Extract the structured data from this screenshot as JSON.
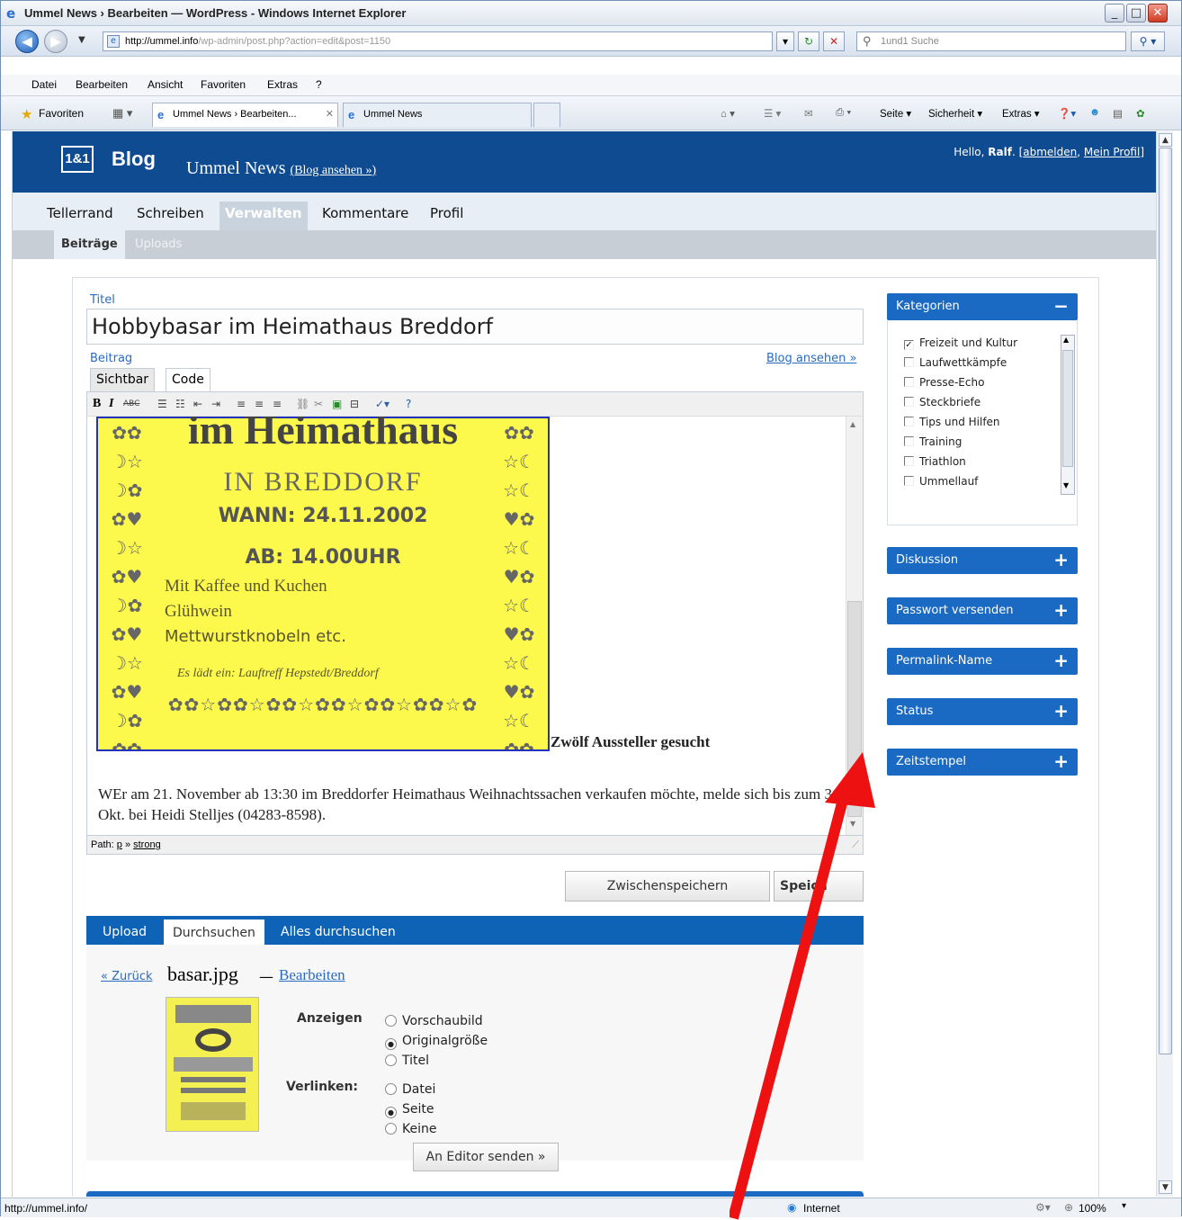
{
  "window": {
    "title": "Ummel News › Bearbeiten — WordPress - Windows Internet Explorer"
  },
  "addressbar": {
    "url_domain": "http://ummel.info",
    "url_path": "/wp-admin/post.php?action=edit&post=1150",
    "search_placeholder": "1und1 Suche"
  },
  "menu": [
    "Datei",
    "Bearbeiten",
    "Ansicht",
    "Favoriten",
    "Extras",
    "?"
  ],
  "favorites": {
    "label": "Favoriten",
    "tabs": [
      "Ummel News › Bearbeiten...",
      "Ummel News"
    ],
    "tools": [
      "Seite ▾",
      "Sicherheit ▾",
      "Extras ▾"
    ]
  },
  "wp_header": {
    "logo": "1&1",
    "blog_word": "Blog",
    "site_name": "Ummel News",
    "view_blog": "(Blog ansehen »)",
    "hello_prefix": "Hello, ",
    "user": "Ralf",
    "logout": "abmelden",
    "profile": "Mein Profil"
  },
  "nav_main": [
    "Tellerrand",
    "Schreiben",
    "Verwalten",
    "Kommentare",
    "Profil"
  ],
  "nav_sub": [
    "Beiträge",
    "Uploads"
  ],
  "editor": {
    "title_label": "Titel",
    "title_value": "Hobbybasar im Heimathaus Breddorf",
    "post_label": "Beitrag",
    "blog_link": "Blog ansehen »",
    "tabs": [
      "Sichtbar",
      "Code"
    ],
    "poster": {
      "line1": "im Heimathaus",
      "line2": "IN BREDDORF",
      "line3": "WANN: 24.11.2002",
      "line4": "AB: 14.00UHR",
      "line5": "Mit Kaffee und Kuchen",
      "line6": "Glühwein",
      "line7": "Mettwurstknobeln etc.",
      "line8": "Es lädt ein: Lauftreff Hepstedt/Breddorf"
    },
    "heading": "Zwölf Aussteller gesucht",
    "body": "WEr am 21. November ab 13:30 im Breddorfer Heimathaus Weihnachtssachen verkaufen möchte, melde sich bis zum 31. Okt. bei Heidi Stelljes (04283-8598).",
    "path_label": "Path:",
    "path_p": "p",
    "path_sep": "»",
    "path_strong": "strong",
    "save_draft": "Zwischenspeichern",
    "save": "Speich"
  },
  "upload": {
    "tabs": [
      "Upload",
      "Durchsuchen",
      "Alles durchsuchen"
    ],
    "back": "« Zurück",
    "filename": "basar.jpg",
    "dash": "—",
    "edit": "Bearbeiten",
    "show_label": "Anzeigen",
    "show_options": [
      "Vorschaubild",
      "Originalgröße",
      "Titel"
    ],
    "link_label": "Verlinken:",
    "link_options": [
      "Datei",
      "Seite",
      "Keine"
    ],
    "send_button": "An Editor senden »"
  },
  "sidebar": {
    "categories_title": "Kategorien",
    "categories": [
      "Freizeit und Kultur",
      "Laufwettkämpfe",
      "Presse-Echo",
      "Steckbriefe",
      "Tips und Hilfen",
      "Training",
      "Triathlon",
      "Ummellauf"
    ],
    "boxes": [
      "Diskussion",
      "Passwort versenden",
      "Permalink-Name",
      "Status",
      "Zeitstempel"
    ]
  },
  "status": {
    "url": "http://ummel.info/",
    "zone": "Internet",
    "zoom": "100%"
  }
}
